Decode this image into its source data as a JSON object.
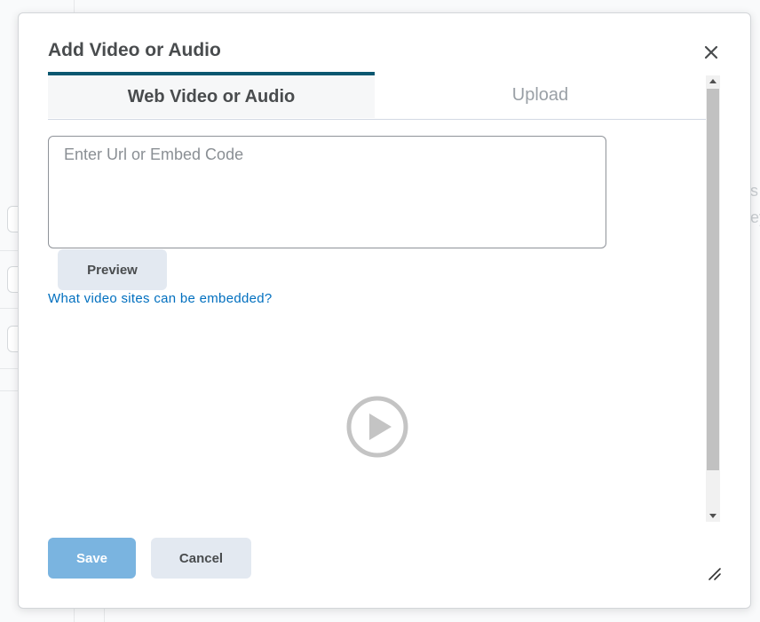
{
  "dialog": {
    "title": "Add Video or Audio",
    "close_icon": "close-icon"
  },
  "tabs": [
    {
      "label": "Web Video or Audio",
      "active": true
    },
    {
      "label": "Upload",
      "active": false
    }
  ],
  "url_input": {
    "placeholder": "Enter Url or Embed Code",
    "value": ""
  },
  "buttons": {
    "preview": "Preview",
    "save": "Save",
    "cancel": "Cancel"
  },
  "help_link": "What video sites can be embedded?",
  "icons": {
    "play": "play-circle-icon",
    "resize": "resize-handle-icon"
  },
  "colors": {
    "accent": "#006fbf",
    "tab_indicator": "#0a5770",
    "save_button": "#7ab4e0",
    "secondary_button": "#e3e9f1",
    "text": "#494c4e"
  },
  "background": {
    "partial_text_1": "s",
    "partial_text_2": "ey"
  }
}
